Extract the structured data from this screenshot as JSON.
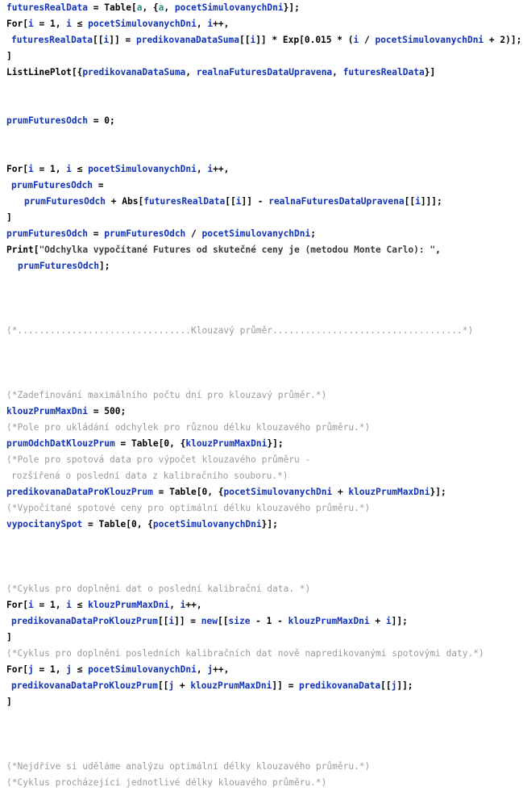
{
  "notebook": {
    "language": "Wolfram Mathematica",
    "colors": {
      "background": "#ffffff",
      "symbol": "#1133bb",
      "local_variable": "#2e8b84",
      "builtin": "#000000",
      "comment": "#9b9b9b",
      "string": "#3b3b3b"
    },
    "cells": [
      {
        "id": "cell-futures-real-data",
        "lines": [
          {
            "indent": 0,
            "kind": "code",
            "text": "futuresRealData = Table[a, {a, pocetSimulovanychDni}];"
          },
          {
            "indent": 0,
            "kind": "code",
            "text": "For[i = 1, i ≤ pocetSimulovanychDni, i++,"
          },
          {
            "indent": 1,
            "kind": "code",
            "text": "futuresRealData[[i]] = predikovanaDataSuma[[i]] * Exp[0.015 * (i / pocetSimulovanychDni + 2)];"
          },
          {
            "indent": 0,
            "kind": "code",
            "text": "]"
          },
          {
            "indent": 0,
            "kind": "code",
            "text": "ListLinePlot[{predikovanaDataSuma, realnaFuturesDataUpravena, futuresRealData}]"
          }
        ]
      },
      {
        "id": "cell-prum-futures-odch",
        "lines": [
          {
            "indent": 0,
            "kind": "code",
            "text": "prumFuturesOdch = 0;"
          }
        ]
      },
      {
        "id": "cell-prum-futures-odch-loop",
        "lines": [
          {
            "indent": 0,
            "kind": "code",
            "text": "For[i = 1, i ≤ pocetSimulovanychDni, i++,"
          },
          {
            "indent": 1,
            "kind": "code",
            "text": "prumFuturesOdch ="
          },
          {
            "indent": 3,
            "kind": "code",
            "text": "prumFuturesOdch + Abs[futuresRealData[[i]] - realnaFuturesDataUpravena[[i]]];"
          },
          {
            "indent": 0,
            "kind": "code",
            "text": "]"
          },
          {
            "indent": 0,
            "kind": "code",
            "text": "prumFuturesOdch = prumFuturesOdch / pocetSimulovanychDni;"
          },
          {
            "indent": 0,
            "kind": "code",
            "text": "Print[\"Odchylka vypočítané Futures od skutečné ceny je (metodou Monte Carlo): \","
          },
          {
            "indent": 2,
            "kind": "code",
            "text": "prumFuturesOdch];"
          }
        ]
      },
      {
        "id": "cell-separator-klouzavy-prumer",
        "lines": [
          {
            "indent": 0,
            "kind": "comment",
            "text": "(*................................Klouzavý průměr...................................*)"
          }
        ]
      },
      {
        "id": "cell-klouz-prum-definice",
        "lines": [
          {
            "indent": 0,
            "kind": "comment",
            "text": "(*Zadefinování maximálního počtu dní pro klouzavý průměr.*)"
          },
          {
            "indent": 0,
            "kind": "code",
            "text": "klouzPrumMaxDni = 500;"
          },
          {
            "indent": 0,
            "kind": "comment",
            "text": "(*Pole pro ukládání odchylek pro různou délku klouzavého průměru.*)"
          },
          {
            "indent": 0,
            "kind": "code",
            "text": "prumOdchDatKlouzPrum = Table[0, {klouzPrumMaxDni}];"
          },
          {
            "indent": 0,
            "kind": "comment",
            "text": "(*Pole pro spotová data pro výpočet klouzavého průměru -"
          },
          {
            "indent": 1,
            "kind": "comment",
            "text": "rozšířená o poslední data z kalibračního souboru.*)"
          },
          {
            "indent": 0,
            "kind": "code",
            "text": "predikovanaDataProKlouzPrum = Table[0, {pocetSimulovanychDni + klouzPrumMaxDni}];"
          },
          {
            "indent": 0,
            "kind": "comment",
            "text": "(*Vypočítané spotové ceny pro optimální délku klouzavého průměru.*)"
          },
          {
            "indent": 0,
            "kind": "code",
            "text": "vypocitanySpot = Table[0, {pocetSimulovanychDni}];"
          }
        ]
      },
      {
        "id": "cell-doplneni-dat",
        "lines": [
          {
            "indent": 0,
            "kind": "comment",
            "text": "(*Cyklus pro doplnění dat o poslední kalibrační data. *)"
          },
          {
            "indent": 0,
            "kind": "code",
            "text": "For[i = 1, i ≤ klouzPrumMaxDni, i++,"
          },
          {
            "indent": 1,
            "kind": "code",
            "text": "predikovanaDataProKlouzPrum[[i]] = new[[size - 1 - klouzPrumMaxDni + i]];"
          },
          {
            "indent": 0,
            "kind": "code",
            "text": "]"
          },
          {
            "indent": 0,
            "kind": "comment",
            "text": "(*Cyklus pro doplnění posledních kalibračních dat nově napredikovanými spotovými daty.*)"
          },
          {
            "indent": 0,
            "kind": "code",
            "text": "For[j = 1, j ≤ pocetSimulovanychDni, j++,"
          },
          {
            "indent": 1,
            "kind": "code",
            "text": "predikovanaDataProKlouzPrum[[j + klouzPrumMaxDni]] = predikovanaData[[j]];"
          },
          {
            "indent": 0,
            "kind": "code",
            "text": "]"
          }
        ]
      },
      {
        "id": "cell-analyza-optimalni-delky",
        "lines": [
          {
            "indent": 0,
            "kind": "comment",
            "text": "(*Nejdříve si uděláme analýzu optimální délky klouzavého průměru.*)"
          },
          {
            "indent": 0,
            "kind": "comment",
            "text": "(*Cyklus procházející jednotlivé délky klouavého průměru.*)"
          }
        ]
      }
    ],
    "gaps": {
      "after_cell_0": "gap-md",
      "after_cell_1": "gap-md",
      "after_cell_2": "gap-lg",
      "after_cell_3": "gap-lg",
      "after_cell_4": "gap-lg",
      "after_cell_5": "gap-lg"
    },
    "symbols": [
      "futuresRealData",
      "pocetSimulovanychDni",
      "predikovanaDataSuma",
      "realnaFuturesDataUpravena",
      "prumFuturesOdch",
      "klouzPrumMaxDni",
      "prumOdchDatKlouzPrum",
      "predikovanaDataProKlouzPrum",
      "vypocitanySpot",
      "predikovanaData",
      "new",
      "size",
      "i",
      "j"
    ],
    "builtins": [
      "Table",
      "For",
      "Exp",
      "ListLinePlot",
      "Abs",
      "Print"
    ],
    "local_variables": [
      "a"
    ]
  }
}
